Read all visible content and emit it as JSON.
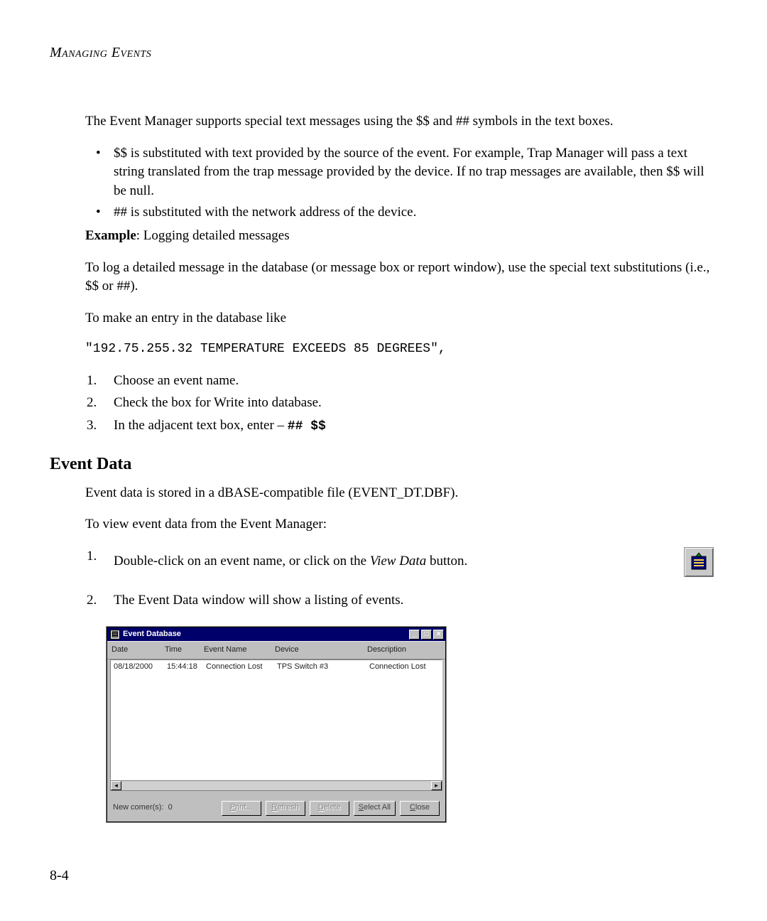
{
  "header": "Managing Events",
  "intro": "The Event Manager supports special text messages using the $$ and ## symbols in the text boxes.",
  "bullets": [
    "$$ is substituted with text provided by the source of the event. For example, Trap Manager will pass a text string translated from the trap message provided by the device. If no trap messages are available, then $$ will be null.",
    "## is substituted with the network address of the device."
  ],
  "example_label": "Example",
  "example_text": ": Logging detailed messages",
  "para_log_detailed": "To log a detailed message in the database (or message box or report window), use the special text substitutions (i.e., $$ or ##).",
  "para_make_entry": "To make an entry in the database like",
  "code_line": "\"192.75.255.32 TEMPERATURE EXCEEDS 85 DEGREES\",",
  "steps1": [
    "Choose an event name.",
    "Check the box for Write into database.",
    "In the adjacent text box, enter – "
  ],
  "step1_code": "##  $$",
  "section_title": "Event Data",
  "para_event_data": "Event data is stored in a dBASE-compatible file (EVENT_DT.DBF).",
  "para_to_view": "To view event data from the Event Manager:",
  "steps2_step1_pre": "Double-click on an event name, or click on the ",
  "steps2_step1_italic": "View Data",
  "steps2_step1_post": " button.",
  "steps2_step2": "The Event Data window will show a listing of events.",
  "window": {
    "title": "Event Database",
    "columns": {
      "date": "Date",
      "time": "Time",
      "event_name": "Event Name",
      "device": "Device",
      "description": "Description"
    },
    "rows": [
      {
        "date": "08/18/2000",
        "time": "15:44:18",
        "event_name": "Connection Lost",
        "device": "TPS Switch #3",
        "description": "Connection Lost"
      }
    ],
    "newcomers_label": "New comer(s):",
    "newcomers_value": "0",
    "buttons": {
      "print": "Print...",
      "refresh": "Refresh",
      "delete": "Delete",
      "select_all": "Select All",
      "close": "Close"
    }
  },
  "page_number": "8-4"
}
